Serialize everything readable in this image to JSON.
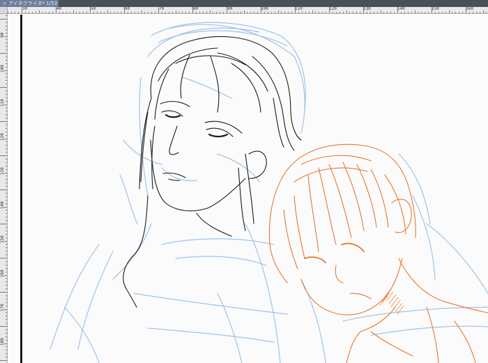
{
  "document_tab": {
    "close_glyph": "×",
    "title": "アイネクライネ* 1/53"
  },
  "rulers": {
    "horizontal_labels": [
      "30",
      "40",
      "50",
      "60",
      "70",
      "80",
      "90",
      "100",
      "110",
      "120",
      "130",
      "140",
      "150",
      "160"
    ],
    "vertical_labels": [
      "90",
      "100",
      "110",
      "120",
      "130",
      "140",
      "150",
      "160",
      "170",
      "180"
    ]
  },
  "colors": {
    "ink": "#1a1a1a",
    "sketch_blue": "#9ec3ea",
    "sketch_orange": "#e8772e",
    "tab_active": "#6b7e9c",
    "tab_bar": "#4b4f57",
    "ruler_bg": "#e9e9e9"
  }
}
